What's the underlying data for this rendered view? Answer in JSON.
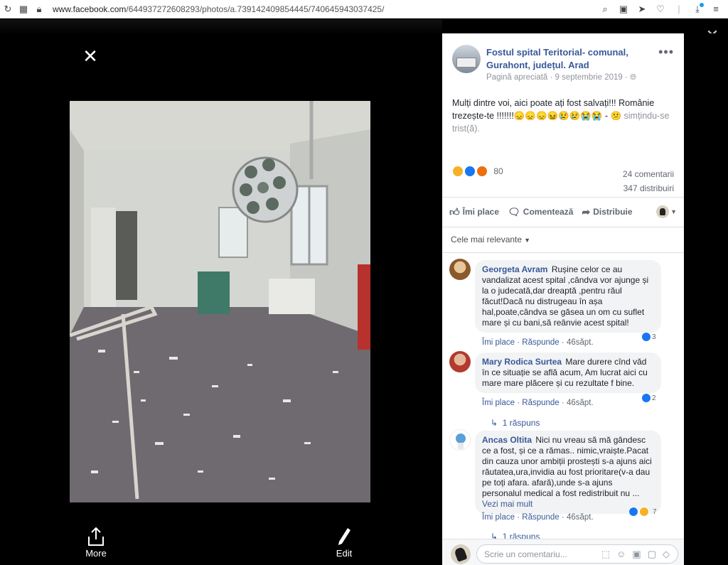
{
  "browser": {
    "url_host": "www.facebook.com",
    "url_path": "/644937272608293/photos/a.739142409854445/740645943037425/"
  },
  "viewer": {
    "more_label": "More",
    "edit_label": "Edit"
  },
  "post": {
    "page_name": "Fostul spital Teritorial- comunal, Gurahont, județul. Arad",
    "meta": "Pagină apreciată · 9 septembrie 2019 · ",
    "text": "Mulți dintre voi, aici poate ați fost salvați!!! Românie trezește-te !!!!!!!😞😞😞😖😢😢😭😭 - 😕",
    "feeling": "simțindu-se trist(ă).",
    "reaction_count": "80",
    "comments_count": "24 comentarii",
    "shares_count": "347 distribuiri",
    "like_label": "Îmi place",
    "comment_label": "Comentează",
    "share_label": "Distribuie",
    "sort_label": "Cele mai relevante"
  },
  "comments": [
    {
      "author": "Georgeta Avram",
      "text": "Rușine celor ce au vandalizat acest spital ,cândva vor ajunge și la o judecată,dar dreaptă ,pentru răul făcut!Dacă nu distrugeau în așa hal,poate,cândva se găsea un om cu suflet mare și cu bani,să reânvie acest spital!",
      "like": "Îmi place",
      "reply": "Răspunde",
      "age": "46săpt.",
      "reactions": "3"
    },
    {
      "author": "Mary Rodica Surtea",
      "text": "Mare durere cînd văd în ce situație se află acum, Am lucrat aici cu mare mare plăcere și cu rezultate f bine.",
      "like": "Îmi place",
      "reply": "Răspunde",
      "age": "46săpt.",
      "reactions": "2",
      "replies": "1 răspuns"
    },
    {
      "author": "Ancas Oltita",
      "text": "Nici nu vreau să mă gândesc ce a fost, și ce a rămas.. nimic,vraiște.Pacat din cauza unor ambiții prostești s-a ajuns aici răutatea,ura,invidia au fost prioritare(v-a dau pe toți afara. afară),unde s-a ajuns personalul medical a fost redistribuit nu ...",
      "see_more": "Vezi mai mult",
      "like": "Îmi place",
      "reply": "Răspunde",
      "age": "46săpt.",
      "reactions": "7",
      "replies": "1 răspuns"
    }
  ],
  "compose": {
    "placeholder": "Scrie un comentariu..."
  }
}
